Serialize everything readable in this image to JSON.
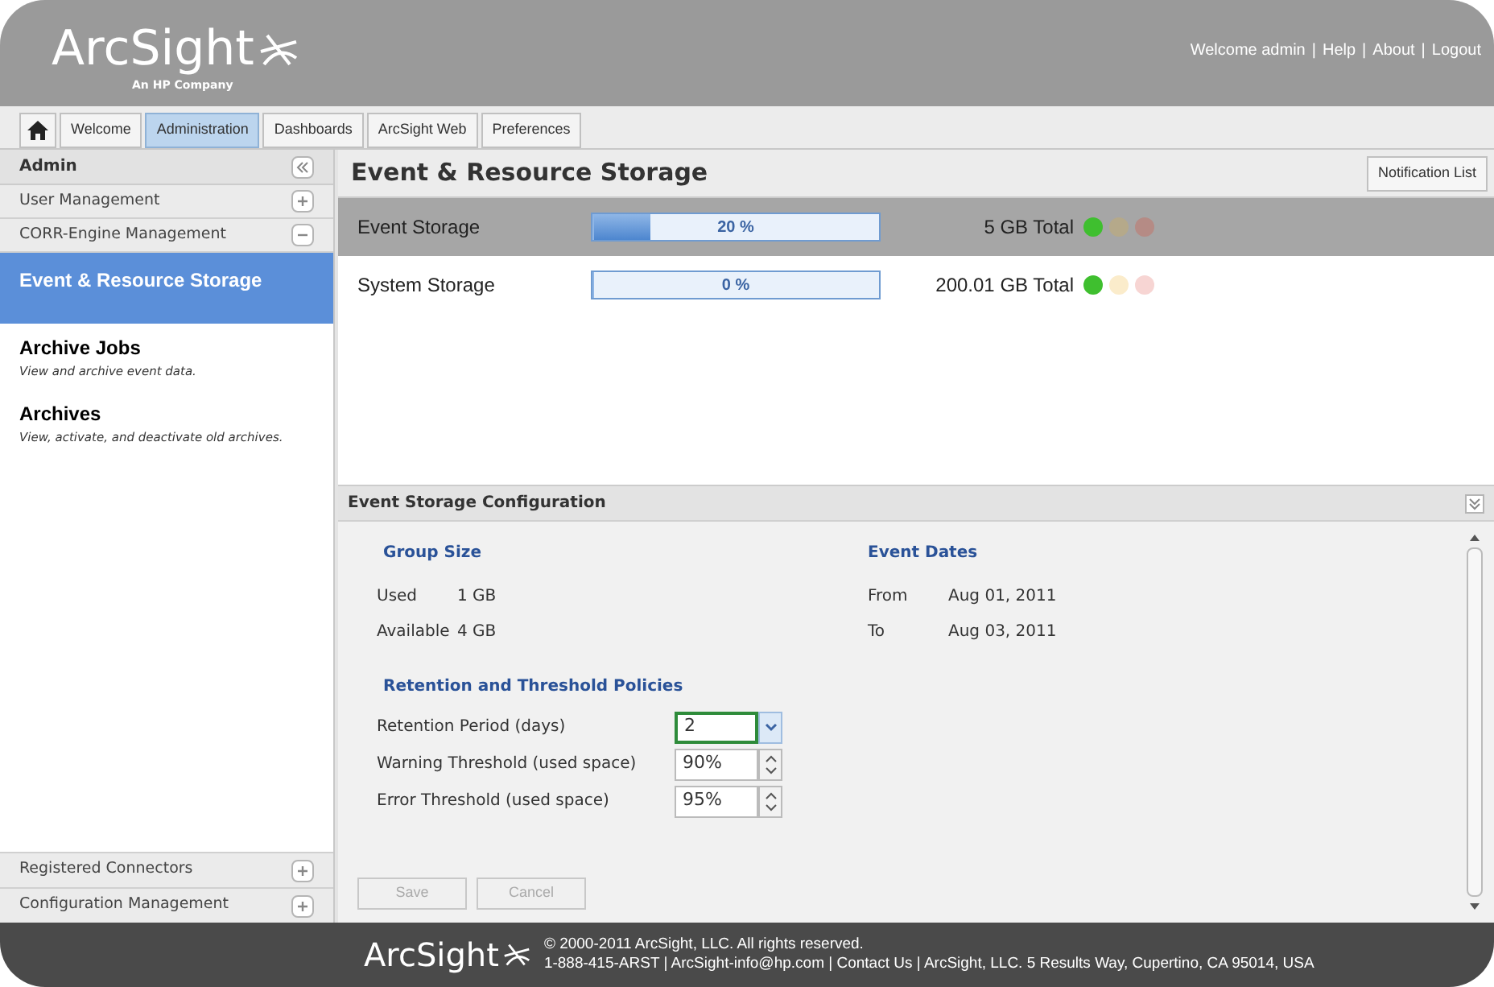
{
  "header": {
    "logo": "ArcSight",
    "logo_sub": "An HP Company",
    "welcome": "Welcome admin",
    "separator": "|",
    "links": [
      "Help",
      "About",
      "Logout"
    ]
  },
  "tabs": [
    {
      "label": "Welcome",
      "selected": false
    },
    {
      "label": "Administration",
      "selected": true
    },
    {
      "label": "Dashboards",
      "selected": false
    },
    {
      "label": "ArcSight Web",
      "selected": false
    },
    {
      "label": "Preferences",
      "selected": false
    }
  ],
  "sidebar": {
    "title": "Admin",
    "sections": [
      {
        "label": "User Management",
        "expanded": false
      },
      {
        "label": "CORR-Engine Management",
        "expanded": true,
        "items": [
          {
            "title": "Event & Resource Storage",
            "selected": true
          },
          {
            "title": "Archive Jobs",
            "description": "View and archive event data.",
            "selected": false
          },
          {
            "title": "Archives",
            "description": "View, activate, and deactivate old archives.",
            "selected": false
          }
        ]
      }
    ],
    "bottom_sections": [
      {
        "label": "Registered Connectors",
        "expanded": false
      },
      {
        "label": "Configuration Management",
        "expanded": false
      }
    ]
  },
  "main": {
    "title": "Event & Resource Storage",
    "notification_button": "Notification List",
    "storage_rows": [
      {
        "name": "Event Storage",
        "level": 0.2,
        "percent": "20 %",
        "total": "5 GB Total",
        "selected": true,
        "lights": [
          {
            "color": "#3fbf2f"
          },
          {
            "color": "#b5a98a"
          },
          {
            "color": "#b58b85"
          }
        ]
      },
      {
        "name": "System Storage",
        "level": 0,
        "percent": "0 %",
        "total": "200.01 GB Total",
        "selected": false,
        "lights": [
          {
            "color": "#3fbf2f"
          },
          {
            "color": "#fbeccb"
          },
          {
            "color": "#f7d5d3"
          }
        ]
      }
    ],
    "config": {
      "title": "Event Storage Configuration",
      "group_size": {
        "title": "Group Size",
        "rows": [
          {
            "label": "Used",
            "value": "1 GB"
          },
          {
            "label": "Available",
            "value": "4 GB"
          }
        ]
      },
      "event_dates": {
        "title": "Event Dates",
        "rows": [
          {
            "label": "From",
            "value": "Aug 01, 2011"
          },
          {
            "label": "To",
            "value": "Aug 03, 2011"
          }
        ]
      },
      "policies": {
        "title": "Retention and Threshold Policies",
        "fields": [
          {
            "label": "Retention Period (days)",
            "value": "2",
            "kind": "dropdown",
            "focused": true
          },
          {
            "label": "Warning Threshold (used space)",
            "value": "90%",
            "kind": "spinner",
            "focused": false
          },
          {
            "label": "Error Threshold (used space)",
            "value": "95%",
            "kind": "spinner",
            "focused": false
          }
        ]
      },
      "buttons": [
        {
          "label": "Save",
          "disabled": true
        },
        {
          "label": "Cancel",
          "disabled": true
        }
      ]
    }
  },
  "footer": {
    "logo": "ArcSight",
    "copyright": "© 2000-2011 ArcSight, LLC. All rights reserved.",
    "contact": "1-888-415-ARST | ArcSight-info@hp.com | Contact Us | ArcSight, LLC. 5 Results Way, Cupertino, CA 95014, USA"
  }
}
